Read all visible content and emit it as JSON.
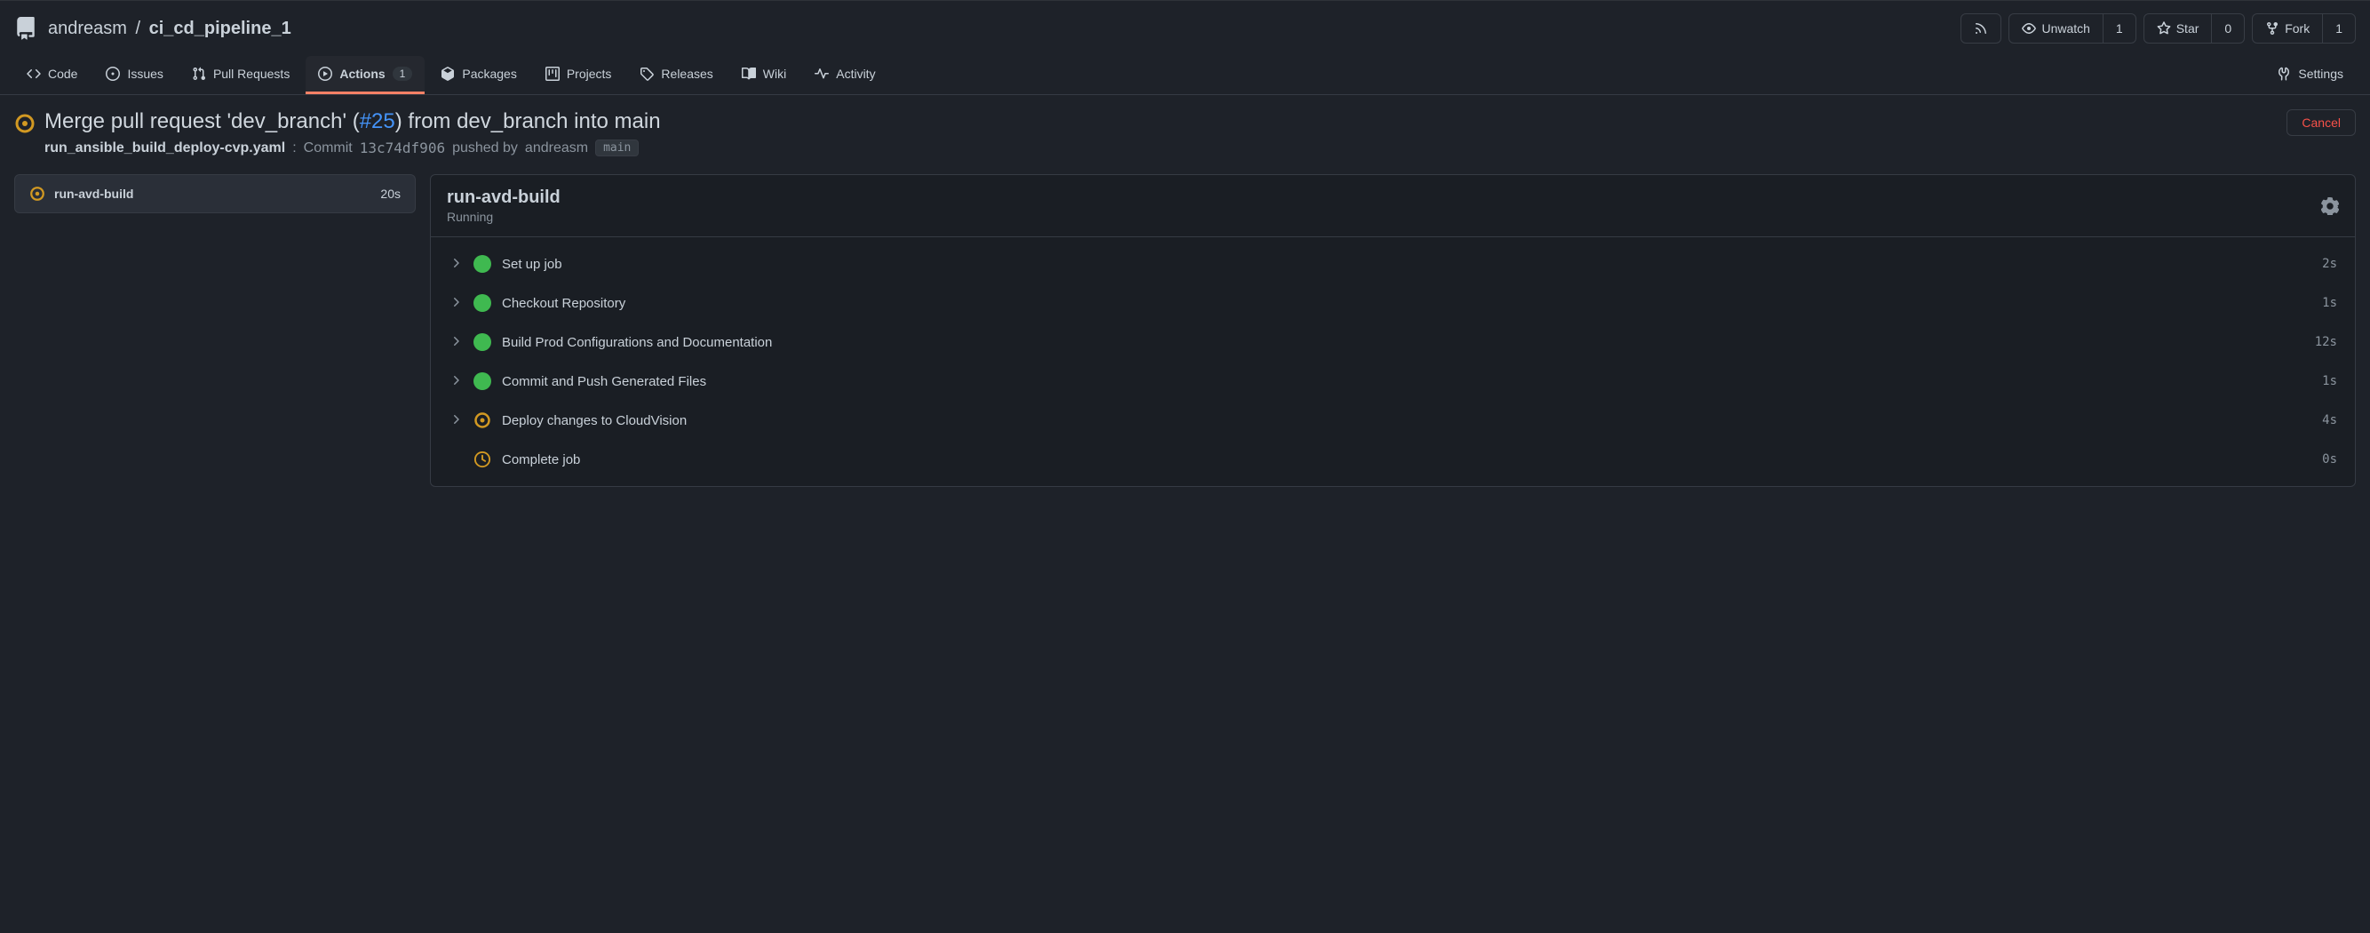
{
  "breadcrumb": {
    "owner": "andreasm",
    "sep": "/",
    "repo": "ci_cd_pipeline_1"
  },
  "headerActions": {
    "unwatch": {
      "label": "Unwatch",
      "count": "1"
    },
    "star": {
      "label": "Star",
      "count": "0"
    },
    "fork": {
      "label": "Fork",
      "count": "1"
    }
  },
  "tabs": {
    "code": "Code",
    "issues": "Issues",
    "pullRequests": "Pull Requests",
    "actions": {
      "label": "Actions",
      "count": "1"
    },
    "packages": "Packages",
    "projects": "Projects",
    "releases": "Releases",
    "wiki": "Wiki",
    "activity": "Activity",
    "settings": "Settings"
  },
  "run": {
    "title_prefix": "Merge pull request 'dev_branch' (",
    "pr": "#25",
    "title_suffix": ") from dev_branch into main",
    "workflowFile": "run_ansible_build_deploy-cvp.yaml",
    "sub_colon": ":",
    "sub_commit_word": "Commit",
    "sha": "13c74df906",
    "sub_pushed": "pushed by",
    "author": "andreasm",
    "branch": "main",
    "cancel": "Cancel"
  },
  "jobCard": {
    "name": "run-avd-build",
    "duration": "20s"
  },
  "jobPanel": {
    "title": "run-avd-build",
    "status": "Running",
    "steps": [
      {
        "name": "Set up job",
        "duration": "2s",
        "status": "success",
        "expandable": true
      },
      {
        "name": "Checkout Repository",
        "duration": "1s",
        "status": "success",
        "expandable": true
      },
      {
        "name": "Build Prod Configurations and Documentation",
        "duration": "12s",
        "status": "success",
        "expandable": true
      },
      {
        "name": "Commit and Push Generated Files",
        "duration": "1s",
        "status": "success",
        "expandable": true
      },
      {
        "name": "Deploy changes to CloudVision",
        "duration": "4s",
        "status": "running",
        "expandable": true
      },
      {
        "name": "Complete job",
        "duration": "0s",
        "status": "pending",
        "expandable": false
      }
    ]
  }
}
